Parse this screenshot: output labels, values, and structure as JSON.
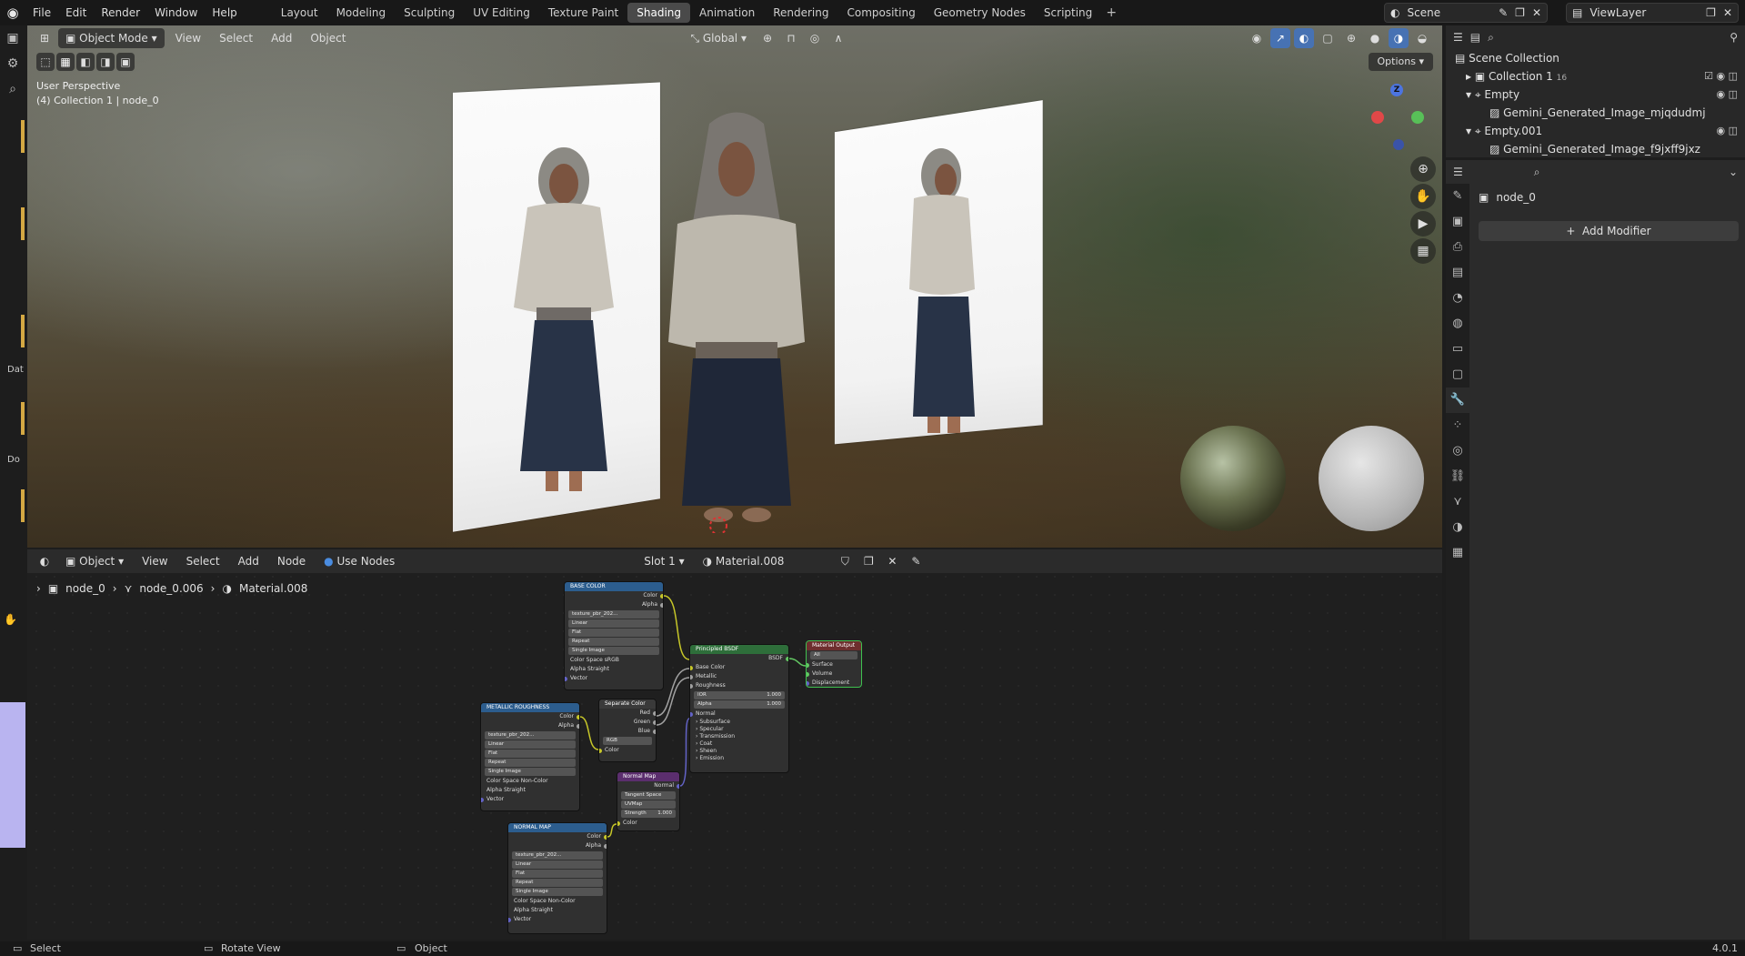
{
  "topbar": {
    "menus": [
      "File",
      "Edit",
      "Render",
      "Window",
      "Help"
    ],
    "workspaces": [
      "Layout",
      "Modeling",
      "Sculpting",
      "UV Editing",
      "Texture Paint",
      "Shading",
      "Animation",
      "Rendering",
      "Compositing",
      "Geometry Nodes",
      "Scripting"
    ],
    "active_workspace": "Shading",
    "scene": "Scene",
    "view_layer": "ViewLayer"
  },
  "viewport": {
    "mode": "Object Mode",
    "menus": [
      "View",
      "Select",
      "Add",
      "Object"
    ],
    "transform_orientation": "Global",
    "options": "Options",
    "info_line1": "User Perspective",
    "info_line2": "(4) Collection 1 | node_0",
    "gizmo_z": "Z",
    "side_labels": [
      "Dat",
      "Do"
    ]
  },
  "node_editor": {
    "editor_type": "Object",
    "menus": [
      "View",
      "Select",
      "Add",
      "Node"
    ],
    "use_nodes": "Use Nodes",
    "slot": "Slot 1",
    "material": "Material.008",
    "breadcrumb": [
      "node_0",
      "node_0.006",
      "Material.008"
    ],
    "nodes": {
      "base_color": {
        "title": "BASE COLOR",
        "out1": "Color",
        "out2": "Alpha",
        "image": "texture_pbr_202...",
        "interp": "Linear",
        "proj": "Flat",
        "ext": "Repeat",
        "src": "Single Image",
        "cs_label": "Color Space",
        "cs": "sRGB",
        "alpha_label": "Alpha",
        "alpha": "Straight",
        "vector": "Vector"
      },
      "metal_rough": {
        "title": "METALLIC ROUGHNESS",
        "out1": "Color",
        "out2": "Alpha",
        "image": "texture_pbr_202...",
        "interp": "Linear",
        "proj": "Flat",
        "ext": "Repeat",
        "src": "Single Image",
        "cs_label": "Color Space",
        "cs": "Non-Color",
        "alpha_label": "Alpha",
        "alpha": "Straight",
        "vector": "Vector"
      },
      "normal_tex": {
        "title": "NORMAL MAP",
        "out1": "Color",
        "out2": "Alpha",
        "image": "texture_pbr_202...",
        "interp": "Linear",
        "proj": "Flat",
        "ext": "Repeat",
        "src": "Single Image",
        "cs_label": "Color Space",
        "cs": "Non-Color",
        "alpha_label": "Alpha",
        "alpha": "Straight",
        "vector": "Vector"
      },
      "separate": {
        "title": "Separate Color",
        "red": "Red",
        "green": "Green",
        "blue": "Blue",
        "mode": "RGB",
        "color": "Color"
      },
      "normal_map": {
        "title": "Normal Map",
        "out": "Normal",
        "space": "Tangent Space",
        "uv": "UVMap",
        "strength_label": "Strength",
        "strength": "1.000",
        "color": "Color"
      },
      "bsdf": {
        "title": "Principled BSDF",
        "out": "BSDF",
        "inputs": [
          "Base Color",
          "Metallic",
          "Roughness"
        ],
        "ior_label": "IOR",
        "ior": "1.000",
        "alpha_label": "Alpha",
        "alpha": "1.000",
        "normal": "Normal",
        "panels": [
          "Subsurface",
          "Specular",
          "Transmission",
          "Coat",
          "Sheen",
          "Emission"
        ]
      },
      "output": {
        "title": "Material Output",
        "target": "All",
        "inputs": [
          "Surface",
          "Volume",
          "Displacement"
        ]
      }
    }
  },
  "outliner": {
    "root": "Scene Collection",
    "rows": [
      {
        "label": "Collection 1",
        "badge": "16"
      },
      {
        "label": "Empty"
      },
      {
        "label": "Gemini_Generated_Image_mjqdudmj"
      },
      {
        "label": "Empty.001"
      },
      {
        "label": "Gemini_Generated_Image_f9jxff9jxz"
      }
    ]
  },
  "properties": {
    "object_name": "node_0",
    "add_modifier": "Add Modifier"
  },
  "statusbar": {
    "select": "Select",
    "rotate": "Rotate View",
    "object": "Object",
    "version": "4.0.1"
  }
}
